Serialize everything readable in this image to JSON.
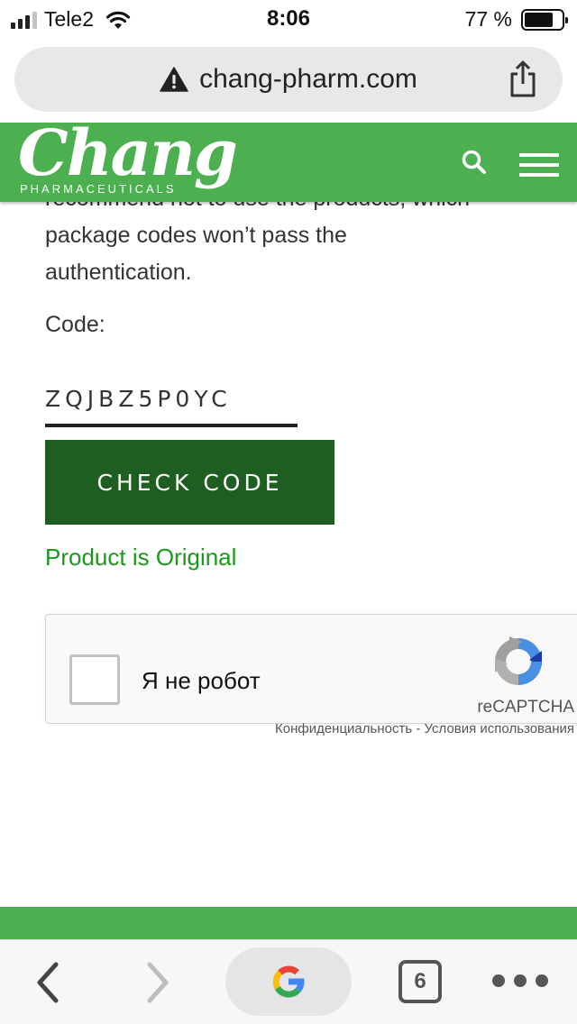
{
  "status_bar": {
    "carrier": "Tele2",
    "time": "8:06",
    "battery": "77 %",
    "battery_level": 0.77
  },
  "browser": {
    "url": "chang-pharm.com",
    "tab_count": "6"
  },
  "header": {
    "logo_word": "Chang",
    "logo_sub": "PHARMACEUTICALS"
  },
  "content": {
    "paragraph_top": "recommend not to use the products, which",
    "paragraph_line2": "package codes won’t pass the",
    "paragraph_line3": "authentication.",
    "code_label": "Code:",
    "code_value": "ZQJBZ5P0YC",
    "check_button": "CHECK CODE",
    "result": "Product is Original"
  },
  "recaptcha": {
    "label": "Я не робот",
    "brand": "reCAPTCHA",
    "privacy": "Конфиденциальность",
    "separator": " - ",
    "terms": "Условия использования"
  },
  "colors": {
    "header_green": "#4caf50",
    "button_green": "#1e5e20",
    "result_green": "#1a9a1a"
  }
}
